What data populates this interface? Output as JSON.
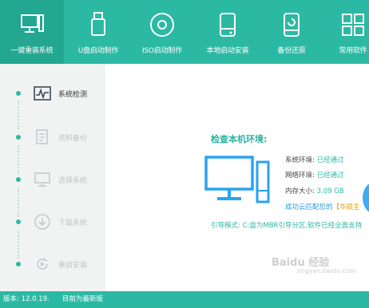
{
  "tabs": [
    {
      "label": "一键重装系统",
      "icon": "monitor-icon",
      "active": true
    },
    {
      "label": "U盘启动制作",
      "icon": "usb-drive-icon"
    },
    {
      "label": "ISO启动制作",
      "icon": "disc-icon"
    },
    {
      "label": "本地启动安装",
      "icon": "hard-disk-icon"
    },
    {
      "label": "备份还原",
      "icon": "backup-restore-icon"
    },
    {
      "label": "常用软件",
      "icon": "apps-grid-icon"
    }
  ],
  "steps": [
    {
      "label": "系统检测",
      "icon": "waveform-icon",
      "active": true
    },
    {
      "label": "资料备份",
      "icon": "documents-icon"
    },
    {
      "label": "选择系统",
      "icon": "monitor-icon"
    },
    {
      "label": "下载系统",
      "icon": "download-icon"
    },
    {
      "label": "重启安装",
      "icon": "restart-icon"
    }
  ],
  "main": {
    "title": "检查本机环境:",
    "rows": [
      {
        "key": "系统环境:",
        "value": "已经通过"
      },
      {
        "key": "网络环境:",
        "value": "已经通过"
      },
      {
        "key": "内存大小:",
        "value": "3.09 GB"
      }
    ],
    "success_prefix": "成功云匹配您的",
    "success_brand": "【华硕主",
    "boot_line": "引导模式: C:盘为MBR引导分区,软件已经全面支持"
  },
  "footer": {
    "version": "版本: 12.0.19.",
    "status": "目前为最新版"
  },
  "watermark": {
    "text": "Baidu 经验",
    "url": "jingyan.baidu.com"
  },
  "colors": {
    "accent": "#2cb9a3",
    "accent_dark": "#23a791",
    "link_blue": "#2a9bd8",
    "brand_orange": "#e0a000"
  }
}
